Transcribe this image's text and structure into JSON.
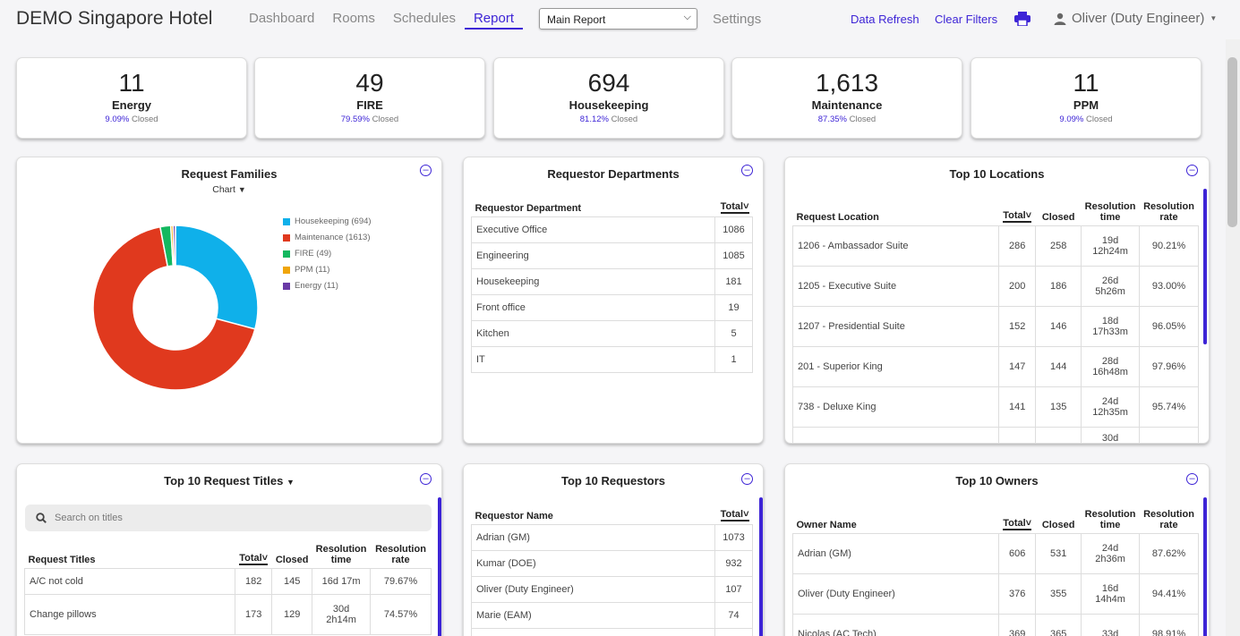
{
  "header": {
    "brand": "DEMO Singapore Hotel",
    "nav": [
      "Dashboard",
      "Rooms",
      "Schedules",
      "Report"
    ],
    "select_value": "Main Report",
    "settings": "Settings",
    "data_refresh": "Data Refresh",
    "clear_filters": "Clear Filters",
    "user": "Oliver (Duty Engineer)"
  },
  "kpis": [
    {
      "value": "11",
      "label": "Energy",
      "pct": "9.09%",
      "suffix": "Closed"
    },
    {
      "value": "49",
      "label": "FIRE",
      "pct": "79.59%",
      "suffix": "Closed"
    },
    {
      "value": "694",
      "label": "Housekeeping",
      "pct": "81.12%",
      "suffix": "Closed"
    },
    {
      "value": "1,613",
      "label": "Maintenance",
      "pct": "87.35%",
      "suffix": "Closed"
    },
    {
      "value": "11",
      "label": "PPM",
      "pct": "9.09%",
      "suffix": "Closed"
    }
  ],
  "families": {
    "title": "Request Families",
    "toggle": "Chart",
    "legend": [
      "Housekeeping (694)",
      "Maintenance (1613)",
      "FIRE (49)",
      "PPM (11)",
      "Energy (11)"
    ]
  },
  "chart_data": {
    "type": "pie",
    "categories": [
      "Housekeeping",
      "Maintenance",
      "FIRE",
      "PPM",
      "Energy"
    ],
    "values": [
      694,
      1613,
      49,
      11,
      11
    ],
    "colors": [
      "#0fb0ea",
      "#e0391e",
      "#13b85f",
      "#f0a50a",
      "#6a3aa6"
    ]
  },
  "departments": {
    "title": "Requestor Departments",
    "headers": [
      "Requestor Department",
      "Total"
    ],
    "rows": [
      [
        "Executive Office",
        "1086"
      ],
      [
        "Engineering",
        "1085"
      ],
      [
        "Housekeeping",
        "181"
      ],
      [
        "Front office",
        "19"
      ],
      [
        "Kitchen",
        "5"
      ],
      [
        "IT",
        "1"
      ]
    ]
  },
  "locations": {
    "title": "Top 10 Locations",
    "headers": [
      "Request Location",
      "Total",
      "Closed",
      "Resolution time",
      "Resolution rate"
    ],
    "rows": [
      [
        "1206 - Ambassador Suite",
        "286",
        "258",
        "19d 12h24m",
        "90.21%"
      ],
      [
        "1205 - Executive Suite",
        "200",
        "186",
        "26d 5h26m",
        "93.00%"
      ],
      [
        "1207 - Presidential Suite",
        "152",
        "146",
        "18d 17h33m",
        "96.05%"
      ],
      [
        "201 - Superior King",
        "147",
        "144",
        "28d 16h48m",
        "97.96%"
      ],
      [
        "738 - Deluxe King",
        "141",
        "135",
        "24d 12h35m",
        "95.74%"
      ],
      [
        "",
        "",
        "",
        "30d",
        ""
      ]
    ]
  },
  "titles": {
    "title": "Top 10 Request Titles",
    "search_placeholder": "Search on titles",
    "headers": [
      "Request Titles",
      "Total",
      "Closed",
      "Resolution time",
      "Resolution rate"
    ],
    "rows": [
      [
        "A/C not cold",
        "182",
        "145",
        "16d 17m",
        "79.67%"
      ],
      [
        "Change pillows",
        "173",
        "129",
        "30d 2h14m",
        "74.57%"
      ]
    ]
  },
  "requestors": {
    "title": "Top 10 Requestors",
    "headers": [
      "Requestor Name",
      "Total"
    ],
    "rows": [
      [
        "Adrian (GM)",
        "1073"
      ],
      [
        "Kumar (DOE)",
        "932"
      ],
      [
        "Oliver (Duty Engineer)",
        "107"
      ],
      [
        "Marie (EAM)",
        "74"
      ]
    ]
  },
  "owners": {
    "title": "Top 10 Owners",
    "headers": [
      "Owner Name",
      "Total",
      "Closed",
      "Resolution time",
      "Resolution rate"
    ],
    "rows": [
      [
        "Adrian (GM)",
        "606",
        "531",
        "24d 2h36m",
        "87.62%"
      ],
      [
        "Oliver (Duty Engineer)",
        "376",
        "355",
        "16d 14h4m",
        "94.41%"
      ],
      [
        "Nicolas (AC Tech)",
        "369",
        "365",
        "33d",
        "98.91%"
      ]
    ]
  }
}
